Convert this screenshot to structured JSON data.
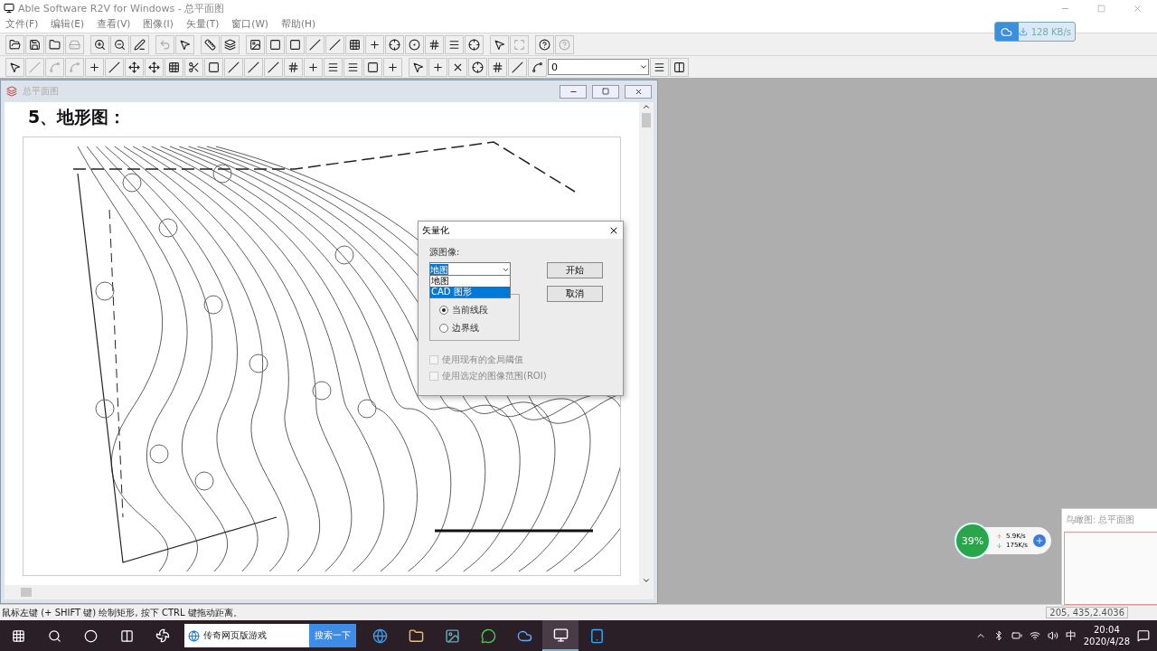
{
  "app": {
    "title": "Able Software R2V for Windows - 总平面图"
  },
  "menu": [
    "文件(F)",
    "编辑(E)",
    "查看(V)",
    "图像(I)",
    "矢量(T)",
    "窗口(W)",
    "帮助(H)"
  ],
  "layer_combo": {
    "value": "0"
  },
  "document": {
    "title": "总平面图",
    "heading": "5、地形图："
  },
  "dialog": {
    "title": "矢量化",
    "source_label": "源图像:",
    "source_value": "地图",
    "source_options": [
      {
        "label": "地图",
        "selected": false
      },
      {
        "label": "CAD 图形",
        "selected": true
      }
    ],
    "radios": [
      {
        "label": "当前线段",
        "selected": true
      },
      {
        "label": "边界线",
        "selected": false
      }
    ],
    "checkboxes": [
      {
        "label": "使用现有的全局阈值",
        "checked": false,
        "disabled": true
      },
      {
        "label": "使用选定的图像范围(ROI)",
        "checked": false,
        "disabled": true
      }
    ],
    "buttons": [
      "开始",
      "取消"
    ]
  },
  "status_bar": {
    "hint": "鼠标左键 (+ SHIFT 键) 绘制矩形, 按下 CTRL 键拖动距离。",
    "coords": "205, 435,2.4036"
  },
  "netdisk_speed": {
    "text": "128 KB/s"
  },
  "network_monitor": {
    "percent": "39%",
    "upload": "5.9K/s",
    "download": "175K/s"
  },
  "overview": {
    "title": "鸟瞰图: 总平面图"
  },
  "taskbar": {
    "search_field": {
      "value": "传奇网页版游戏"
    },
    "search_button": "搜索一下",
    "ime": "中",
    "time": "20:04",
    "date": "2020/4/28"
  }
}
